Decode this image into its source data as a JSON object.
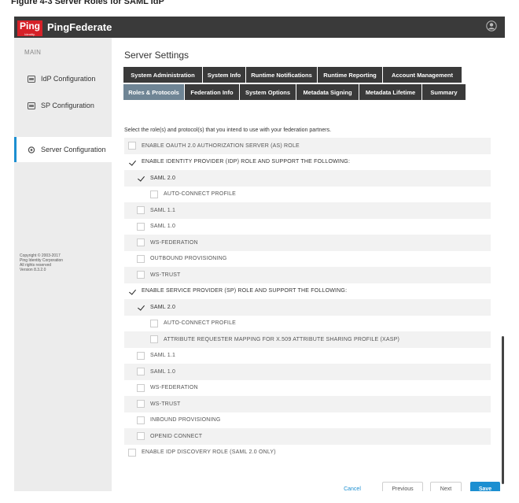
{
  "caption": "Figure 4-3 Server Roles for SAML IdP",
  "app": {
    "logo": "Ping",
    "logo_sub": "Identity.",
    "product": "PingFederate"
  },
  "sidebar": {
    "section_label": "MAIN",
    "items": [
      {
        "label": "IdP Configuration",
        "icon": "idp-icon",
        "active": false
      },
      {
        "label": "SP Configuration",
        "icon": "sp-icon",
        "active": false
      },
      {
        "label": "Server Configuration",
        "icon": "server-gear-icon",
        "active": true
      }
    ],
    "copyright": [
      "Copyright © 2003-2017",
      "Ping Identity Corporation",
      "All rights reserved",
      "Version 8.3.2.0"
    ]
  },
  "page": {
    "title": "Server Settings",
    "tabs_row1": [
      "System Administration",
      "System Info",
      "Runtime Notifications",
      "Runtime Reporting",
      "Account Management"
    ],
    "tabs_row2": [
      "Roles & Protocols",
      "Federation Info",
      "System Options",
      "Metadata Signing",
      "Metadata Lifetime",
      "Summary"
    ],
    "active_tab": "Roles & Protocols",
    "instructions": "Select the role(s) and protocol(s) that you intend to use with your federation partners."
  },
  "roles": [
    {
      "label": "ENABLE OAUTH 2.0 AUTHORIZATION SERVER (AS) ROLE",
      "checked": false,
      "level": 0
    },
    {
      "label": "ENABLE IDENTITY PROVIDER (IDP) ROLE AND SUPPORT THE FOLLOWING:",
      "checked": true,
      "level": 0
    },
    {
      "label": "SAML 2.0",
      "checked": true,
      "level": 1
    },
    {
      "label": "AUTO-CONNECT PROFILE",
      "checked": false,
      "level": 2
    },
    {
      "label": "SAML 1.1",
      "checked": false,
      "level": 1
    },
    {
      "label": "SAML 1.0",
      "checked": false,
      "level": 1
    },
    {
      "label": "WS-FEDERATION",
      "checked": false,
      "level": 1
    },
    {
      "label": "OUTBOUND PROVISIONING",
      "checked": false,
      "level": 1
    },
    {
      "label": "WS-TRUST",
      "checked": false,
      "level": 1
    },
    {
      "label": "ENABLE SERVICE PROVIDER (SP) ROLE AND SUPPORT THE FOLLOWING:",
      "checked": true,
      "level": 0
    },
    {
      "label": "SAML 2.0",
      "checked": true,
      "level": 1
    },
    {
      "label": "AUTO-CONNECT PROFILE",
      "checked": false,
      "level": 2
    },
    {
      "label": "ATTRIBUTE REQUESTER MAPPING FOR X.509 ATTRIBUTE SHARING PROFILE (XASP)",
      "checked": false,
      "level": 2
    },
    {
      "label": "SAML 1.1",
      "checked": false,
      "level": 1
    },
    {
      "label": "SAML 1.0",
      "checked": false,
      "level": 1
    },
    {
      "label": "WS-FEDERATION",
      "checked": false,
      "level": 1
    },
    {
      "label": "WS-TRUST",
      "checked": false,
      "level": 1
    },
    {
      "label": "INBOUND PROVISIONING",
      "checked": false,
      "level": 1
    },
    {
      "label": "OPENID CONNECT",
      "checked": false,
      "level": 1
    },
    {
      "label": "ENABLE IDP DISCOVERY ROLE (SAML 2.0 ONLY)",
      "checked": false,
      "level": 0
    }
  ],
  "buttons": {
    "cancel": "Cancel",
    "previous": "Previous",
    "next": "Next",
    "save": "Save"
  },
  "colors": {
    "topbar": "#3a3a3a",
    "brand_red": "#d62128",
    "accent_blue": "#1c8fd1",
    "tab_dark": "#3a3a3a",
    "tab_active": "#6f8595",
    "sidebar_bg": "#ececec"
  }
}
